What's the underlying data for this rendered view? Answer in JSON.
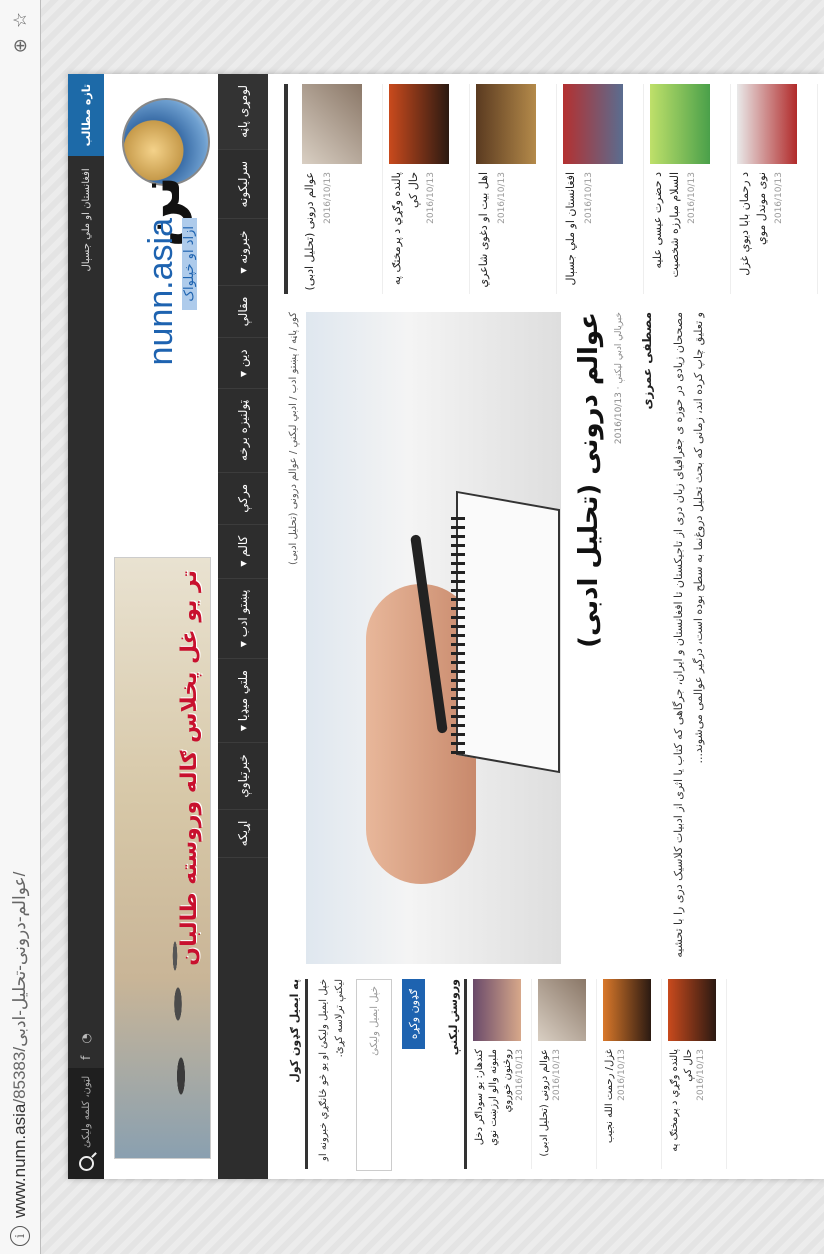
{
  "browser": {
    "url_host": "www.nunn.asia",
    "url_path": "/85383/عوالم-درونی-تحلیل-ادبی/"
  },
  "topbar": {
    "news_label": "تازه مطالب",
    "ticker": "افغانستان او ملي جسېال",
    "search_placeholder": "لټون، کلمه ولیکئ"
  },
  "logo": {
    "name": "nunn.asia",
    "mark": "نن",
    "tagline": "ازاد او خپلواک"
  },
  "banner": {
    "slogan": "تر یو غل پخلاس ګاله وروسته طالبان"
  },
  "nav": {
    "items": [
      "لومړی پاڼه",
      "سرلیکونه",
      "خبرونه ▾",
      "مقالې",
      "دین ▾",
      "ټولنیزه برخه",
      "مرکې",
      "کالم ▾",
      "پښتو ادب ▾",
      "ملتي میډیا ▾",
      "خبرتیاوې",
      "اړیکه"
    ]
  },
  "article": {
    "breadcrumb": "کور پاڼه / پښتو ادب / ادبي لیکنې / عوالم درونی (تحلیل ادبی)",
    "title": "عوالم درونی (تحلیل ادبی)",
    "meta": "خبریالي ادبي لیکنې · 2016/10/13",
    "author": "مصطفی عمرزی",
    "body": "مصححان زیادی در حوزه ی جغرافیای زبان دری از تاجیکستان تا افغانستان و ایران، جرگاهی که کتاب یا اثری از ادبیات کلاسیک دری را با تحشیه و تعلیق چاپ کرده اند، زمانی که بحث تحلیل دروغ‌نما به سطح بوده است، درگیر عوالمی می‌شوند..."
  },
  "right_list": [
    {
      "title": "عوالم درونی (تحلیل ادبی)",
      "date": "2016/10/13"
    },
    {
      "title": "پالنده وګړي د پرمختګ په حال کې",
      "date": "2016/10/13"
    },
    {
      "title": "اهل بیت او دغوی شاعري",
      "date": "2016/10/13"
    },
    {
      "title": "افغانستان او ملي جسېال",
      "date": "2016/10/13"
    },
    {
      "title": "د حضرت عیسی علیه السلام مبارزه شخصیت",
      "date": "2016/10/13"
    },
    {
      "title": "د رحمان بابا دیوې غزل نوی موندل موي",
      "date": "2016/10/13"
    }
  ],
  "subscribe": {
    "heading": "په ایمیل ګډون کول",
    "text": "خپل ایمیل ولیکئ او یو څو ځانګړي خبرونه او لیکنې ترلاسه کړئ.",
    "placeholder": "خپل ایمیل ولیکئ",
    "button": "ګډون وکړه"
  },
  "latest": {
    "heading": "وروستۍ لیکنې",
    "items": [
      {
        "title": "کندهار: یو سوداګر دخل ملبونه والو ارزښت نوي روڅنون خوروي",
        "date": "2016/10/13"
      },
      {
        "title": "عوالم درونی (تحلیل ادبی)",
        "date": "2016/10/13"
      },
      {
        "title": "غزل/ رحمت الله نجیب",
        "date": "2016/10/13"
      },
      {
        "title": "پالنده وګړي د پرمختګ په حال کې",
        "date": "2016/10/13"
      }
    ]
  },
  "colors": {
    "dark_bar": "#2d2d2d",
    "accent_blue": "#1e63b0",
    "banner_red": "#c8102e"
  }
}
